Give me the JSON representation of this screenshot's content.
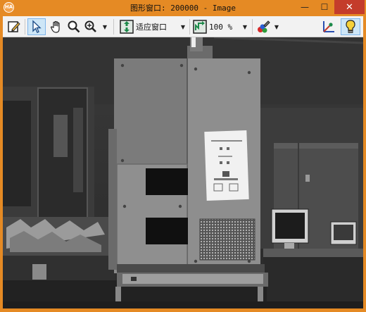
{
  "window": {
    "app_icon_text": "HA",
    "title": "图形窗口: 200000 - Image",
    "minimize_glyph": "—",
    "maximize_glyph": "☐",
    "close_glyph": "✕"
  },
  "toolbar": {
    "fit_label": "适应窗口",
    "zoom_label": "100 %"
  },
  "icons": [
    "edit-icon",
    "pointer-icon",
    "hand-icon",
    "zoom-icon",
    "zoom-dropdown-icon",
    "fit-window-icon",
    "fit-dropdown-icon",
    "zoom-level-icon",
    "zoom-level-dropdown-icon",
    "color-icon",
    "color-dropdown-icon",
    "axes-icon",
    "lightbulb-icon"
  ],
  "colors": {
    "title_bar": "#e58a24",
    "close_button": "#c43c2b",
    "toolbar": "#f2f2f2",
    "selected_tool": "#cde6f7"
  }
}
